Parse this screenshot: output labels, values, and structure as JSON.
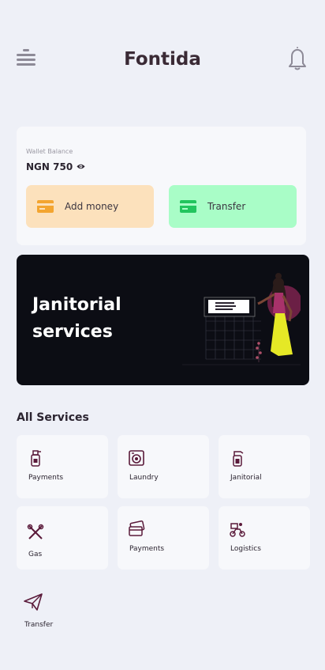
{
  "header": {
    "title": "Fontida",
    "menu_icon": "hamburger-menu-icon",
    "notification_icon": "bell-icon"
  },
  "wallet": {
    "label": "Wallet Balance",
    "amount": "NGN 750",
    "visibility_icon": "eye-icon",
    "add_money_label": "Add money",
    "transfer_label": "Transfer"
  },
  "banner": {
    "title": "Janitorial services"
  },
  "services": {
    "title": "All Services",
    "items": [
      {
        "label": "Payments",
        "icon": "spray-bottle-icon"
      },
      {
        "label": "Laundry",
        "icon": "washing-machine-icon"
      },
      {
        "label": "Janitorial",
        "icon": "cleaning-spray-icon"
      },
      {
        "label": "Gas",
        "icon": "tools-icon"
      },
      {
        "label": "Payments",
        "icon": "payment-card-icon"
      },
      {
        "label": "Logistics",
        "icon": "delivery-bike-icon"
      },
      {
        "label": "Transfer",
        "icon": "paper-plane-icon"
      }
    ]
  },
  "colors": {
    "background": "#eef0f7",
    "add_money_bg": "#fce1bc",
    "transfer_bg": "#a9fdc7",
    "banner_bg": "#0c0d14",
    "icon_accent": "#5a1a3a"
  }
}
